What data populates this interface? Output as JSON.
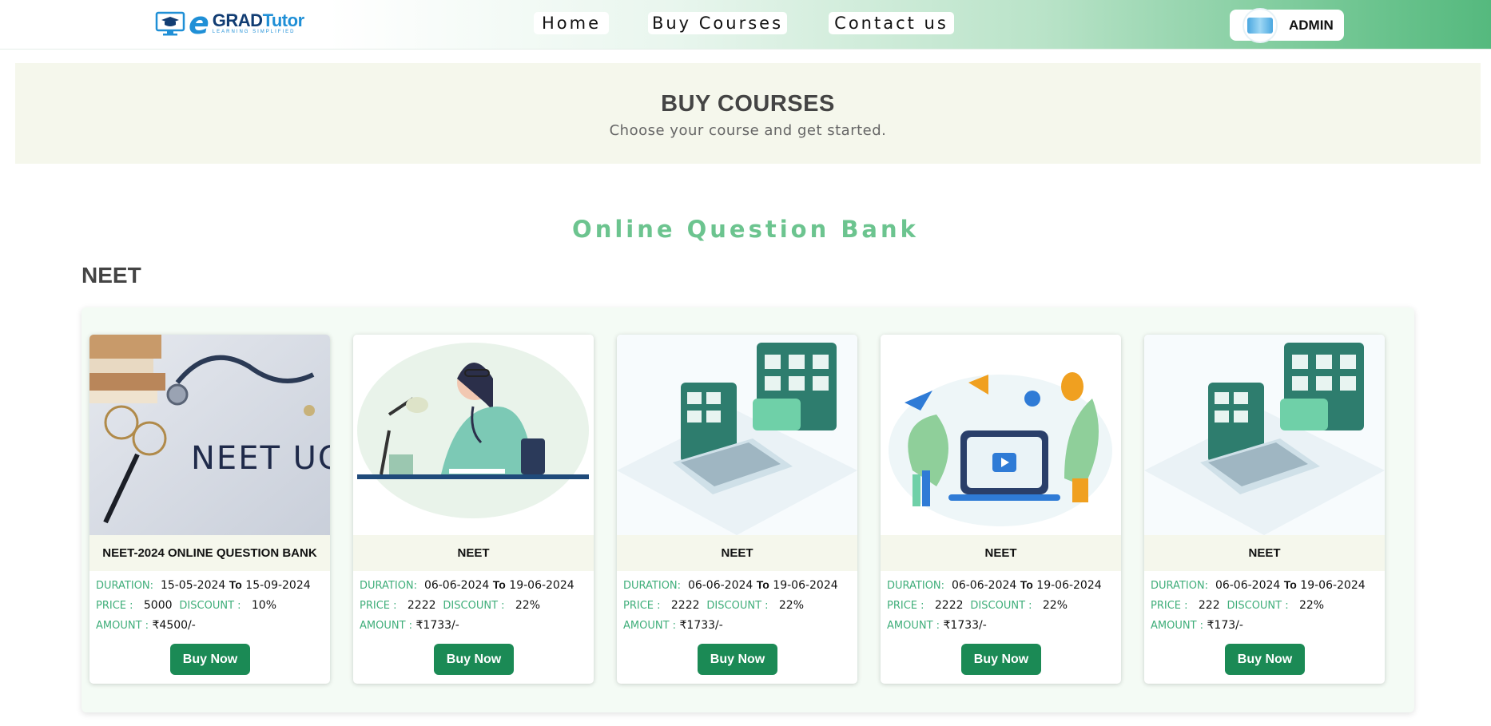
{
  "header": {
    "logo_e": "e",
    "logo_grad": "GRAD",
    "logo_tutor": "Tutor",
    "logo_tagline": "LEARNING SIMPLIFIED",
    "nav": [
      {
        "label": "Home"
      },
      {
        "label": "Buy Courses"
      },
      {
        "label": "Contact us"
      }
    ],
    "user_label": "ADMIN"
  },
  "hero": {
    "title": "BUY COURSES",
    "subtitle": "Choose your course and get started."
  },
  "section_title": "Online Question Bank",
  "category": "NEET",
  "labels": {
    "duration": "DURATION:",
    "to": "To",
    "price": "PRICE :",
    "discount": "DISCOUNT :",
    "amount": "AMOUNT :",
    "buy": "Buy Now"
  },
  "courses": [
    {
      "name": "NEET-2024 ONLINE QUESTION BANK",
      "start": "15-05-2024",
      "end": "15-09-2024",
      "price": "5000",
      "discount": "10%",
      "amount": "₹4500/-",
      "image": "neet-ug-stethoscope-books",
      "image_text": "NEET UG"
    },
    {
      "name": "NEET",
      "start": "06-06-2024",
      "end": "19-06-2024",
      "price": "2222",
      "discount": "22%",
      "amount": "₹1733/-",
      "image": "doctor-studying-illustration"
    },
    {
      "name": "NEET",
      "start": "06-06-2024",
      "end": "19-06-2024",
      "price": "2222",
      "discount": "22%",
      "amount": "₹1733/-",
      "image": "online-test-laptop-illustration"
    },
    {
      "name": "NEET",
      "start": "06-06-2024",
      "end": "19-06-2024",
      "price": "2222",
      "discount": "22%",
      "amount": "₹1733/-",
      "image": "video-learning-illustration"
    },
    {
      "name": "NEET",
      "start": "06-06-2024",
      "end": "19-06-2024",
      "price": "222",
      "discount": "22%",
      "amount": "₹173/-",
      "image": "online-test-laptop-illustration"
    }
  ],
  "colors": {
    "accent_green": "#6cc48f",
    "button_green": "#1b8a55",
    "label_green": "#3fae7a",
    "hero_bg": "#f5f7ec"
  }
}
